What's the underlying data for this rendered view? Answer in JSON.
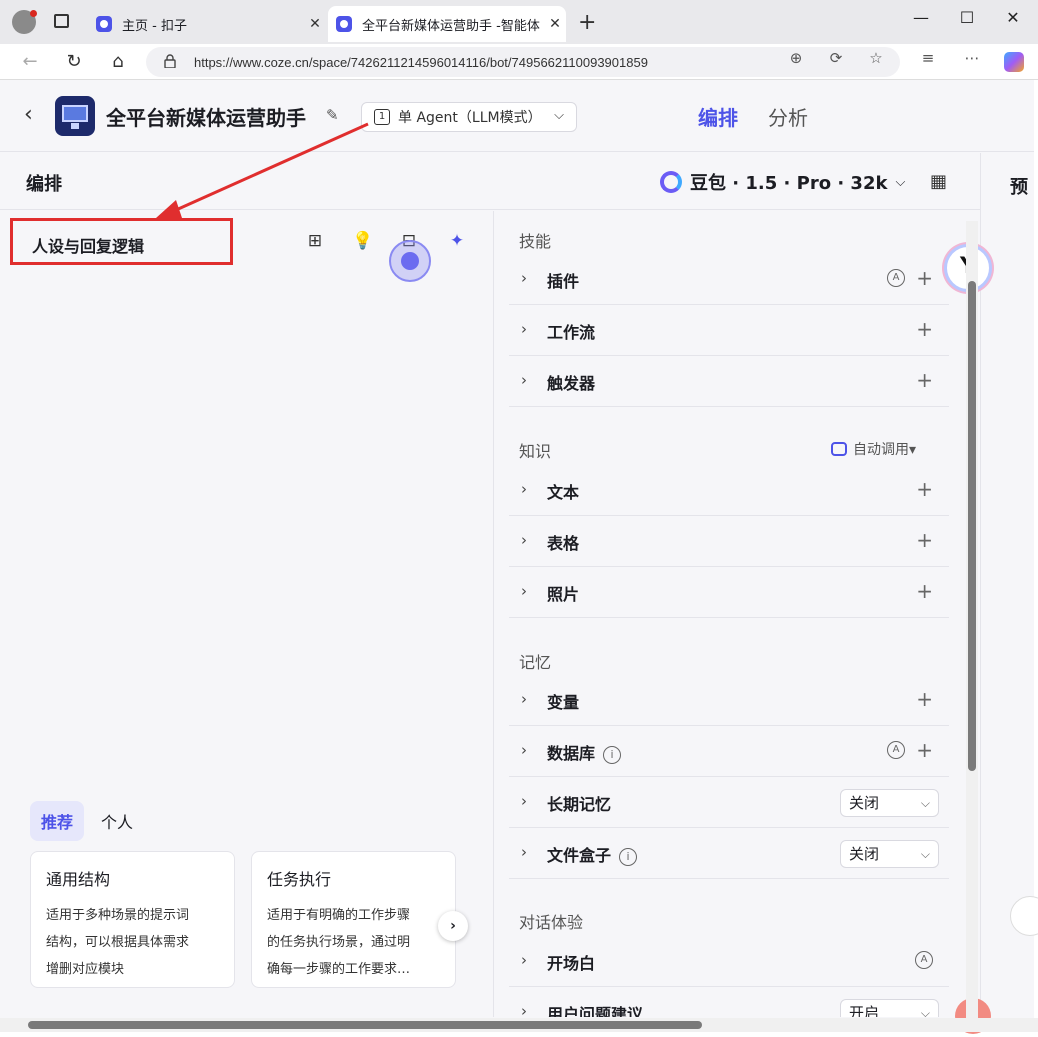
{
  "browser": {
    "tabs": [
      {
        "title": "主页 - 扣子",
        "active": false
      },
      {
        "title": "全平台新媒体运营助手 -智能体 - 扣",
        "active": true
      }
    ],
    "url": "https://www.coze.cn/space/7426211214596014116/bot/7495662110093901859",
    "new_tab": "+",
    "close": "✕",
    "minimize": "—",
    "maximize": "☐"
  },
  "header": {
    "bot_name": "全平台新媒体运营助手",
    "mode_label": "单 Agent（LLM模式）",
    "tabs": [
      {
        "label": "编排",
        "active": true
      },
      {
        "label": "分析",
        "active": false
      }
    ]
  },
  "subheader": {
    "title": "编排",
    "model": "豆包 · 1.5 · Pro · 32k",
    "preview": "预"
  },
  "editor": {
    "persona_title": "人设与回复逻辑",
    "recommend_tabs": [
      {
        "label": "推荐",
        "active": true
      },
      {
        "label": "个人",
        "active": false
      }
    ],
    "cards": [
      {
        "title": "通用结构",
        "lines": [
          "适用于多种场景的提示词",
          "结构，可以根据具体需求",
          "增删对应模块"
        ]
      },
      {
        "title": "任务执行",
        "lines": [
          "适用于有明确的工作步骤",
          "的任务执行场景，通过明",
          "确每一步骤的工作要求…"
        ]
      }
    ]
  },
  "skills": {
    "section": "技能",
    "items": [
      {
        "label": "插件",
        "auto": true
      },
      {
        "label": "工作流",
        "auto": false
      },
      {
        "label": "触发器",
        "auto": false
      }
    ]
  },
  "knowledge": {
    "section": "知识",
    "auto_call": "自动调用▾",
    "items": [
      {
        "label": "文本"
      },
      {
        "label": "表格"
      },
      {
        "label": "照片"
      }
    ]
  },
  "memory": {
    "section": "记忆",
    "variable": "变量",
    "database": "数据库",
    "long_term": "长期记忆",
    "long_term_value": "关闭",
    "filebox": "文件盒子",
    "filebox_value": "关闭"
  },
  "dialog": {
    "section": "对话体验",
    "opening": "开场白",
    "suggest": "用户问题建议",
    "suggest_value": "开启"
  },
  "colors": {
    "accent": "#4d53e8",
    "annotation": "#e02e2e"
  }
}
